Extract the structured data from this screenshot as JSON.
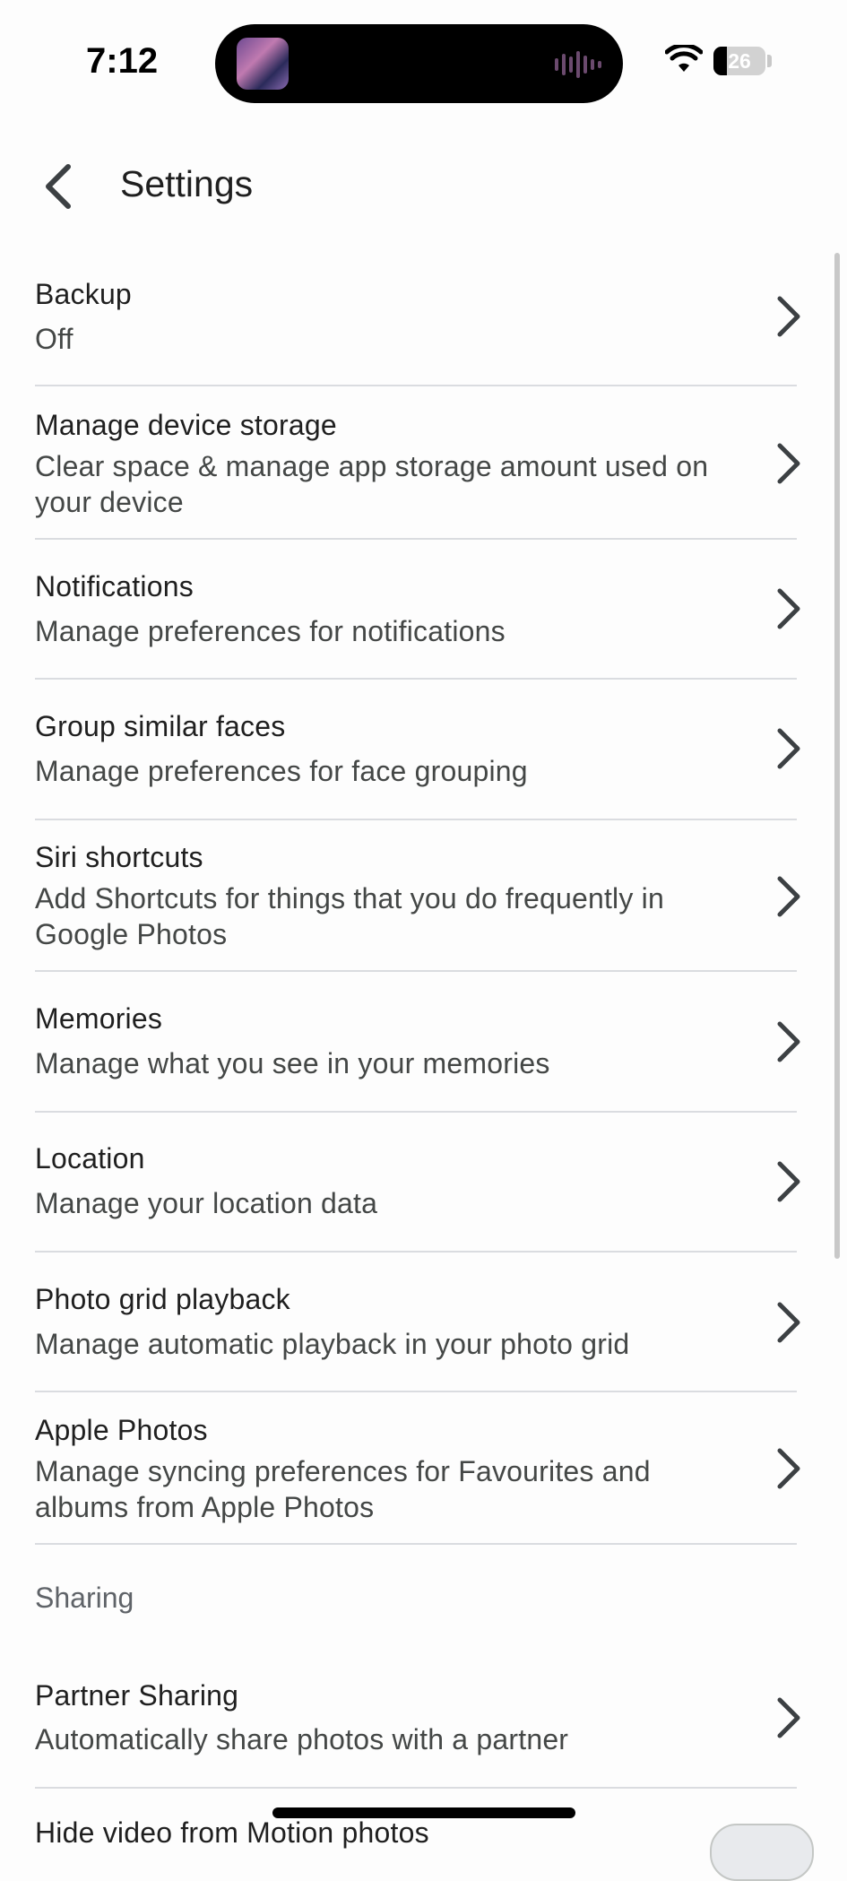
{
  "status_bar": {
    "time": "7:12",
    "battery_level": "26",
    "battery_fraction": 0.26,
    "icons": [
      "wifi-icon",
      "battery-icon",
      "now-playing-artwork",
      "audio-waveform-icon"
    ]
  },
  "header": {
    "back_icon": "chevron-left-icon",
    "title": "Settings"
  },
  "items": [
    {
      "title": "Backup",
      "subtitle": "Off"
    },
    {
      "title": "Manage device storage",
      "subtitle": "Clear space & manage app storage amount used on your device"
    },
    {
      "title": "Notifications",
      "subtitle": "Manage preferences for notifications"
    },
    {
      "title": "Group similar faces",
      "subtitle": "Manage preferences for face grouping"
    },
    {
      "title": "Siri shortcuts",
      "subtitle": "Add Shortcuts for things that you do frequently in Google Photos"
    },
    {
      "title": "Memories",
      "subtitle": "Manage what you see in your memories"
    },
    {
      "title": "Location",
      "subtitle": "Manage your location data"
    },
    {
      "title": "Photo grid playback",
      "subtitle": "Manage automatic playback in your photo grid"
    },
    {
      "title": "Apple Photos",
      "subtitle": "Manage syncing preferences for Favourites and albums from Apple Photos"
    }
  ],
  "sharing_section": {
    "label": "Sharing",
    "items": [
      {
        "title": "Partner Sharing",
        "subtitle": "Automatically share photos with a partner"
      },
      {
        "title": "Hide video from Motion photos",
        "toggle": "off"
      }
    ]
  },
  "colors": {
    "background": "#fdfdfd",
    "title_text": "#1f1f1f",
    "subtitle_text": "#444746",
    "divider": "#dadce0",
    "section_label": "#5f6368"
  }
}
